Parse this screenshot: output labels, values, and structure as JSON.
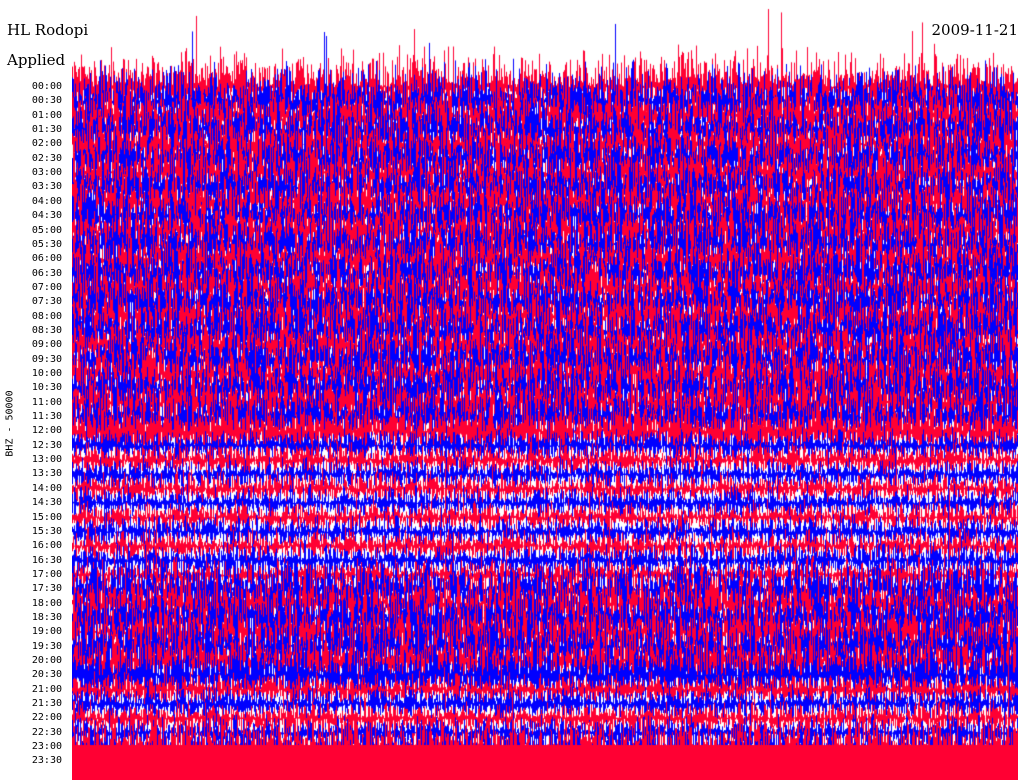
{
  "header": {
    "station": "HL Rodopi",
    "filter_label": "Applied",
    "date": "2009-11-21"
  },
  "channel_label": "BHZ - 50000",
  "trace_colors": [
    "#ff0033",
    "#0000ff"
  ],
  "time_labels": [
    "00:00",
    "00:30",
    "01:00",
    "01:30",
    "02:00",
    "02:30",
    "03:00",
    "03:30",
    "04:00",
    "04:30",
    "05:00",
    "05:30",
    "06:00",
    "06:30",
    "07:00",
    "07:30",
    "08:00",
    "08:30",
    "09:00",
    "09:30",
    "10:00",
    "10:30",
    "11:00",
    "11:30",
    "12:00",
    "12:30",
    "13:00",
    "13:30",
    "14:00",
    "14:30",
    "15:00",
    "15:30",
    "16:00",
    "16:30",
    "17:00",
    "17:30",
    "18:00",
    "18:30",
    "19:00",
    "19:30",
    "20:00",
    "20:30",
    "21:00",
    "21:30",
    "22:00",
    "22:30",
    "23:00",
    "23:30"
  ]
}
